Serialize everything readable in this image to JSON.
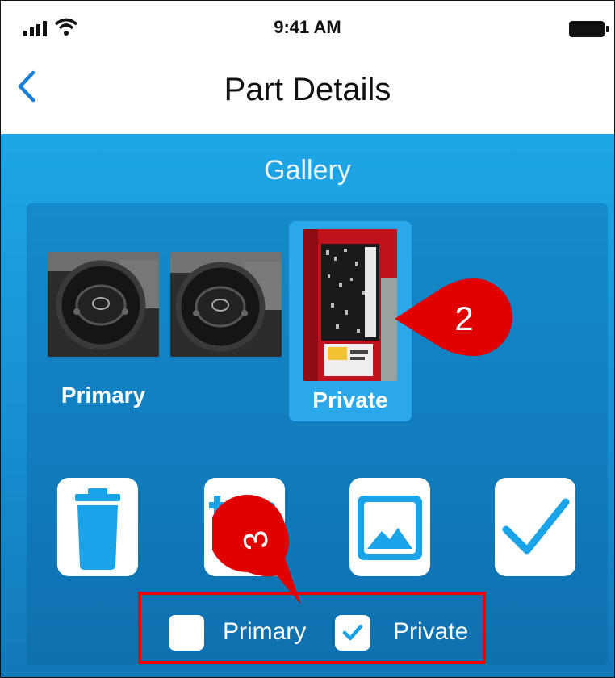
{
  "status_bar": {
    "time": "9:41 AM",
    "signal_icon": "cellular-signal-icon",
    "wifi_icon": "wifi-icon",
    "battery_icon": "battery-icon"
  },
  "nav": {
    "back_icon": "chevron-left-icon",
    "title": "Part Details"
  },
  "gallery": {
    "title": "Gallery",
    "items": [
      {
        "image": "steering-wheel-photo",
        "caption": "Primary"
      },
      {
        "image": "steering-wheel-photo",
        "caption": ""
      },
      {
        "image": "door-jamb-label-photo",
        "caption": "Private",
        "selected": true
      }
    ]
  },
  "toolbar": {
    "actions": [
      {
        "icon": "trash-icon"
      },
      {
        "icon": "add-photos-icon"
      },
      {
        "icon": "image-icon"
      },
      {
        "icon": "checkmark-icon"
      }
    ]
  },
  "options": {
    "primary": {
      "label": "Primary",
      "checked": false
    },
    "private": {
      "label": "Private",
      "checked": true
    }
  },
  "annotations": {
    "marker_2": "2",
    "marker_3": "3",
    "color": "#e00000"
  },
  "colors": {
    "accent": "#1a9ee0",
    "nav_tint": "#1a7fd9"
  }
}
